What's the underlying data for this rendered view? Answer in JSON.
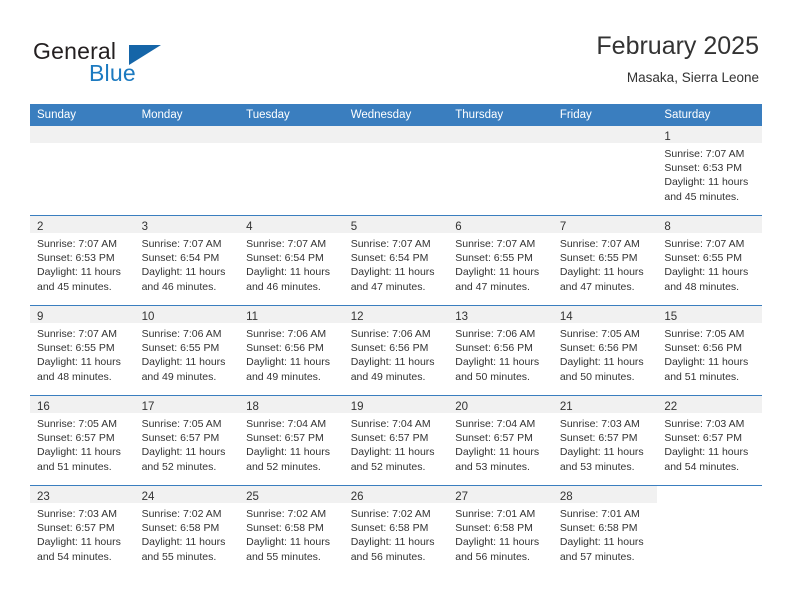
{
  "brand": {
    "name_part1": "General",
    "name_part2": "Blue",
    "accent_color": "#1c7ac0",
    "triangle_color": "#1565a8"
  },
  "header": {
    "title": "February 2025",
    "subtitle": "Masaka, Sierra Leone"
  },
  "theme": {
    "header_row_bg": "#3a7ebf",
    "daynum_band_bg": "#f1f1f1",
    "text_color": "#333333"
  },
  "weekdays": [
    "Sunday",
    "Monday",
    "Tuesday",
    "Wednesday",
    "Thursday",
    "Friday",
    "Saturday"
  ],
  "weeks": [
    [
      {
        "day": "",
        "empty": true,
        "band": true,
        "sunrise": "",
        "sunset": "",
        "daylight_line1": "",
        "daylight_line2": ""
      },
      {
        "day": "",
        "empty": true,
        "band": true,
        "sunrise": "",
        "sunset": "",
        "daylight_line1": "",
        "daylight_line2": ""
      },
      {
        "day": "",
        "empty": true,
        "band": true,
        "sunrise": "",
        "sunset": "",
        "daylight_line1": "",
        "daylight_line2": ""
      },
      {
        "day": "",
        "empty": true,
        "band": true,
        "sunrise": "",
        "sunset": "",
        "daylight_line1": "",
        "daylight_line2": ""
      },
      {
        "day": "",
        "empty": true,
        "band": true,
        "sunrise": "",
        "sunset": "",
        "daylight_line1": "",
        "daylight_line2": ""
      },
      {
        "day": "",
        "empty": true,
        "band": true,
        "sunrise": "",
        "sunset": "",
        "daylight_line1": "",
        "daylight_line2": ""
      },
      {
        "day": "1",
        "empty": false,
        "band": true,
        "sunrise": "Sunrise: 7:07 AM",
        "sunset": "Sunset: 6:53 PM",
        "daylight_line1": "Daylight: 11 hours",
        "daylight_line2": "and 45 minutes."
      }
    ],
    [
      {
        "day": "2",
        "empty": false,
        "band": true,
        "sunrise": "Sunrise: 7:07 AM",
        "sunset": "Sunset: 6:53 PM",
        "daylight_line1": "Daylight: 11 hours",
        "daylight_line2": "and 45 minutes."
      },
      {
        "day": "3",
        "empty": false,
        "band": true,
        "sunrise": "Sunrise: 7:07 AM",
        "sunset": "Sunset: 6:54 PM",
        "daylight_line1": "Daylight: 11 hours",
        "daylight_line2": "and 46 minutes."
      },
      {
        "day": "4",
        "empty": false,
        "band": true,
        "sunrise": "Sunrise: 7:07 AM",
        "sunset": "Sunset: 6:54 PM",
        "daylight_line1": "Daylight: 11 hours",
        "daylight_line2": "and 46 minutes."
      },
      {
        "day": "5",
        "empty": false,
        "band": true,
        "sunrise": "Sunrise: 7:07 AM",
        "sunset": "Sunset: 6:54 PM",
        "daylight_line1": "Daylight: 11 hours",
        "daylight_line2": "and 47 minutes."
      },
      {
        "day": "6",
        "empty": false,
        "band": true,
        "sunrise": "Sunrise: 7:07 AM",
        "sunset": "Sunset: 6:55 PM",
        "daylight_line1": "Daylight: 11 hours",
        "daylight_line2": "and 47 minutes."
      },
      {
        "day": "7",
        "empty": false,
        "band": true,
        "sunrise": "Sunrise: 7:07 AM",
        "sunset": "Sunset: 6:55 PM",
        "daylight_line1": "Daylight: 11 hours",
        "daylight_line2": "and 47 minutes."
      },
      {
        "day": "8",
        "empty": false,
        "band": true,
        "sunrise": "Sunrise: 7:07 AM",
        "sunset": "Sunset: 6:55 PM",
        "daylight_line1": "Daylight: 11 hours",
        "daylight_line2": "and 48 minutes."
      }
    ],
    [
      {
        "day": "9",
        "empty": false,
        "band": true,
        "sunrise": "Sunrise: 7:07 AM",
        "sunset": "Sunset: 6:55 PM",
        "daylight_line1": "Daylight: 11 hours",
        "daylight_line2": "and 48 minutes."
      },
      {
        "day": "10",
        "empty": false,
        "band": true,
        "sunrise": "Sunrise: 7:06 AM",
        "sunset": "Sunset: 6:55 PM",
        "daylight_line1": "Daylight: 11 hours",
        "daylight_line2": "and 49 minutes."
      },
      {
        "day": "11",
        "empty": false,
        "band": true,
        "sunrise": "Sunrise: 7:06 AM",
        "sunset": "Sunset: 6:56 PM",
        "daylight_line1": "Daylight: 11 hours",
        "daylight_line2": "and 49 minutes."
      },
      {
        "day": "12",
        "empty": false,
        "band": true,
        "sunrise": "Sunrise: 7:06 AM",
        "sunset": "Sunset: 6:56 PM",
        "daylight_line1": "Daylight: 11 hours",
        "daylight_line2": "and 49 minutes."
      },
      {
        "day": "13",
        "empty": false,
        "band": true,
        "sunrise": "Sunrise: 7:06 AM",
        "sunset": "Sunset: 6:56 PM",
        "daylight_line1": "Daylight: 11 hours",
        "daylight_line2": "and 50 minutes."
      },
      {
        "day": "14",
        "empty": false,
        "band": true,
        "sunrise": "Sunrise: 7:05 AM",
        "sunset": "Sunset: 6:56 PM",
        "daylight_line1": "Daylight: 11 hours",
        "daylight_line2": "and 50 minutes."
      },
      {
        "day": "15",
        "empty": false,
        "band": true,
        "sunrise": "Sunrise: 7:05 AM",
        "sunset": "Sunset: 6:56 PM",
        "daylight_line1": "Daylight: 11 hours",
        "daylight_line2": "and 51 minutes."
      }
    ],
    [
      {
        "day": "16",
        "empty": false,
        "band": true,
        "sunrise": "Sunrise: 7:05 AM",
        "sunset": "Sunset: 6:57 PM",
        "daylight_line1": "Daylight: 11 hours",
        "daylight_line2": "and 51 minutes."
      },
      {
        "day": "17",
        "empty": false,
        "band": true,
        "sunrise": "Sunrise: 7:05 AM",
        "sunset": "Sunset: 6:57 PM",
        "daylight_line1": "Daylight: 11 hours",
        "daylight_line2": "and 52 minutes."
      },
      {
        "day": "18",
        "empty": false,
        "band": true,
        "sunrise": "Sunrise: 7:04 AM",
        "sunset": "Sunset: 6:57 PM",
        "daylight_line1": "Daylight: 11 hours",
        "daylight_line2": "and 52 minutes."
      },
      {
        "day": "19",
        "empty": false,
        "band": true,
        "sunrise": "Sunrise: 7:04 AM",
        "sunset": "Sunset: 6:57 PM",
        "daylight_line1": "Daylight: 11 hours",
        "daylight_line2": "and 52 minutes."
      },
      {
        "day": "20",
        "empty": false,
        "band": true,
        "sunrise": "Sunrise: 7:04 AM",
        "sunset": "Sunset: 6:57 PM",
        "daylight_line1": "Daylight: 11 hours",
        "daylight_line2": "and 53 minutes."
      },
      {
        "day": "21",
        "empty": false,
        "band": true,
        "sunrise": "Sunrise: 7:03 AM",
        "sunset": "Sunset: 6:57 PM",
        "daylight_line1": "Daylight: 11 hours",
        "daylight_line2": "and 53 minutes."
      },
      {
        "day": "22",
        "empty": false,
        "band": true,
        "sunrise": "Sunrise: 7:03 AM",
        "sunset": "Sunset: 6:57 PM",
        "daylight_line1": "Daylight: 11 hours",
        "daylight_line2": "and 54 minutes."
      }
    ],
    [
      {
        "day": "23",
        "empty": false,
        "band": true,
        "sunrise": "Sunrise: 7:03 AM",
        "sunset": "Sunset: 6:57 PM",
        "daylight_line1": "Daylight: 11 hours",
        "daylight_line2": "and 54 minutes."
      },
      {
        "day": "24",
        "empty": false,
        "band": true,
        "sunrise": "Sunrise: 7:02 AM",
        "sunset": "Sunset: 6:58 PM",
        "daylight_line1": "Daylight: 11 hours",
        "daylight_line2": "and 55 minutes."
      },
      {
        "day": "25",
        "empty": false,
        "band": true,
        "sunrise": "Sunrise: 7:02 AM",
        "sunset": "Sunset: 6:58 PM",
        "daylight_line1": "Daylight: 11 hours",
        "daylight_line2": "and 55 minutes."
      },
      {
        "day": "26",
        "empty": false,
        "band": true,
        "sunrise": "Sunrise: 7:02 AM",
        "sunset": "Sunset: 6:58 PM",
        "daylight_line1": "Daylight: 11 hours",
        "daylight_line2": "and 56 minutes."
      },
      {
        "day": "27",
        "empty": false,
        "band": true,
        "sunrise": "Sunrise: 7:01 AM",
        "sunset": "Sunset: 6:58 PM",
        "daylight_line1": "Daylight: 11 hours",
        "daylight_line2": "and 56 minutes."
      },
      {
        "day": "28",
        "empty": false,
        "band": true,
        "sunrise": "Sunrise: 7:01 AM",
        "sunset": "Sunset: 6:58 PM",
        "daylight_line1": "Daylight: 11 hours",
        "daylight_line2": "and 57 minutes."
      },
      {
        "day": "",
        "empty": true,
        "band": false,
        "sunrise": "",
        "sunset": "",
        "daylight_line1": "",
        "daylight_line2": ""
      }
    ]
  ]
}
